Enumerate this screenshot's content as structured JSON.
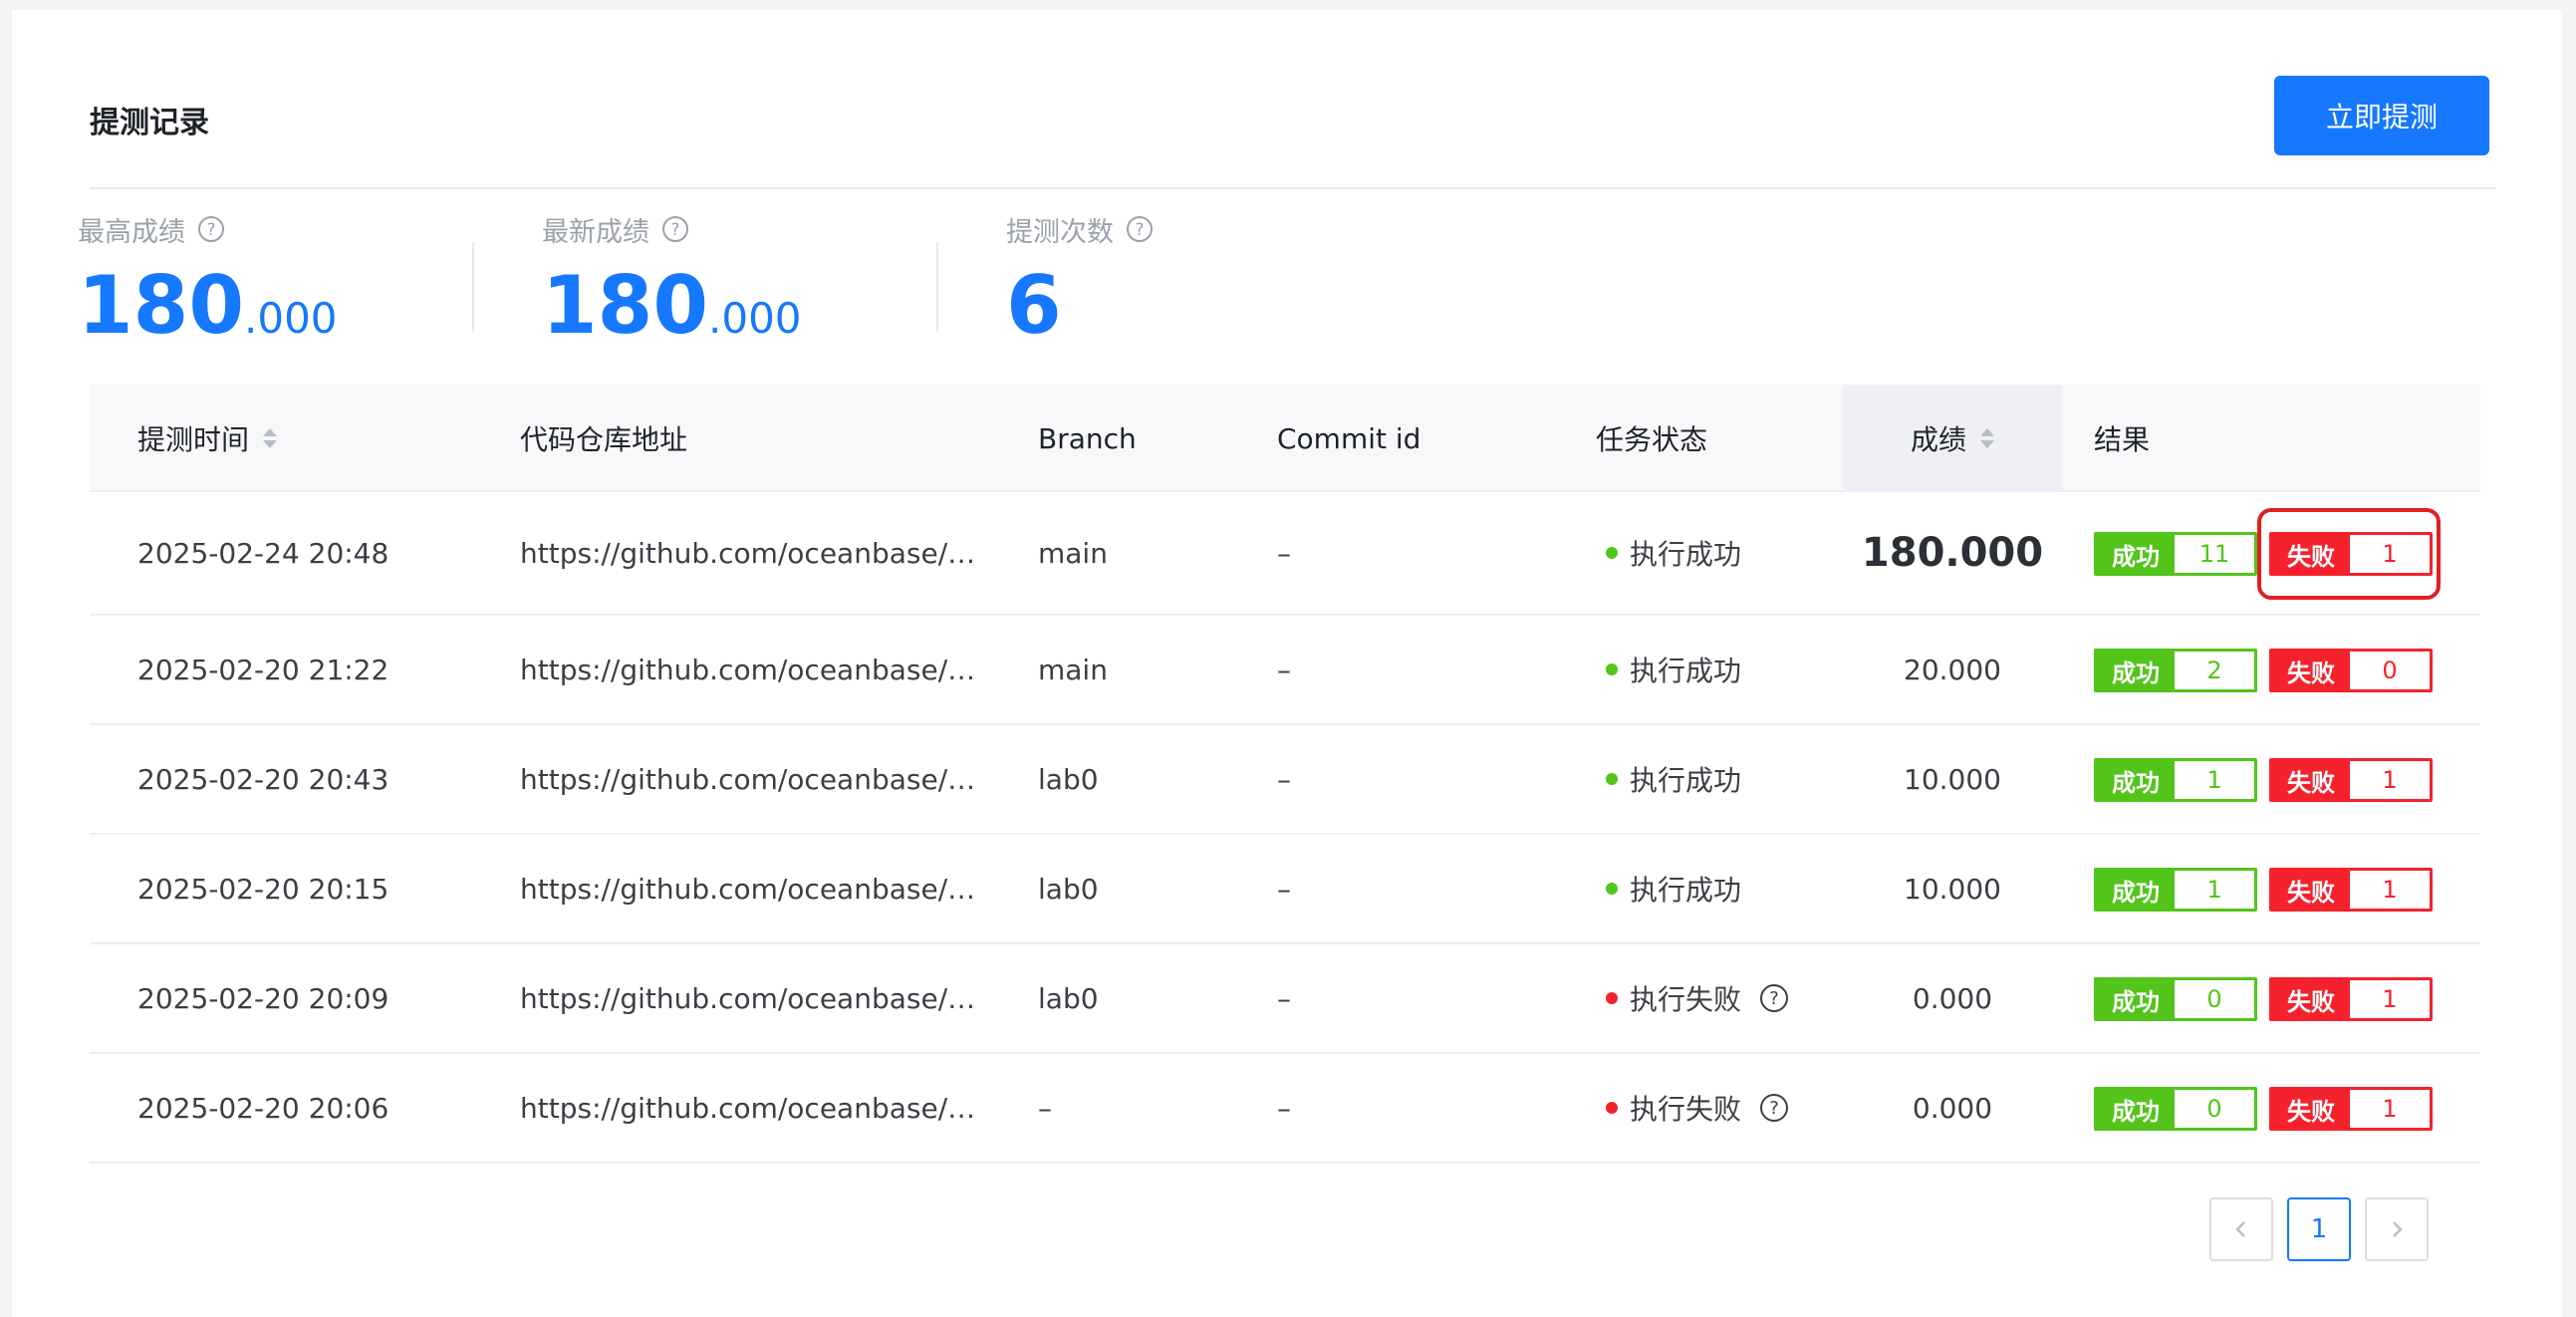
{
  "header": {
    "title": "提测记录",
    "submit_button": "立即提测"
  },
  "stats": [
    {
      "label": "最高成绩",
      "int": "180",
      "dec": ".000"
    },
    {
      "label": "最新成绩",
      "int": "180",
      "dec": ".000"
    },
    {
      "label": "提测次数",
      "int": "6",
      "dec": ""
    }
  ],
  "table": {
    "columns": [
      "提测时间",
      "代码仓库地址",
      "Branch",
      "Commit id",
      "任务状态",
      "成绩",
      "结果"
    ],
    "success_label": "成功",
    "fail_label": "失败",
    "rows": [
      {
        "time": "2025-02-24 20:48",
        "repo": "https://github.com/oceanbase/…",
        "branch": "main",
        "commit": "–",
        "status": "执行成功",
        "score": "180.000",
        "succ": "11",
        "fail": "1"
      },
      {
        "time": "2025-02-20 21:22",
        "repo": "https://github.com/oceanbase/…",
        "branch": "main",
        "commit": "–",
        "status": "执行成功",
        "score": "20.000",
        "succ": "2",
        "fail": "0"
      },
      {
        "time": "2025-02-20 20:43",
        "repo": "https://github.com/oceanbase/…",
        "branch": "lab0",
        "commit": "–",
        "status": "执行成功",
        "score": "10.000",
        "succ": "1",
        "fail": "1"
      },
      {
        "time": "2025-02-20 20:15",
        "repo": "https://github.com/oceanbase/…",
        "branch": "lab0",
        "commit": "–",
        "status": "执行成功",
        "score": "10.000",
        "succ": "1",
        "fail": "1"
      },
      {
        "time": "2025-02-20 20:09",
        "repo": "https://github.com/oceanbase/…",
        "branch": "lab0",
        "commit": "–",
        "status": "执行失败",
        "score": "0.000",
        "succ": "0",
        "fail": "1"
      },
      {
        "time": "2025-02-20 20:06",
        "repo": "https://github.com/oceanbase/…",
        "branch": "–",
        "commit": "–",
        "status": "执行失败",
        "score": "0.000",
        "succ": "0",
        "fail": "1"
      }
    ]
  },
  "pagination": {
    "prev_icon": "chevron-left-icon",
    "current_page": "1",
    "next_icon": "chevron-right-icon"
  },
  "colors": {
    "primary": "#1677ff",
    "success": "#52c41a",
    "danger": "#f5222d",
    "highlight": "#e02020"
  }
}
